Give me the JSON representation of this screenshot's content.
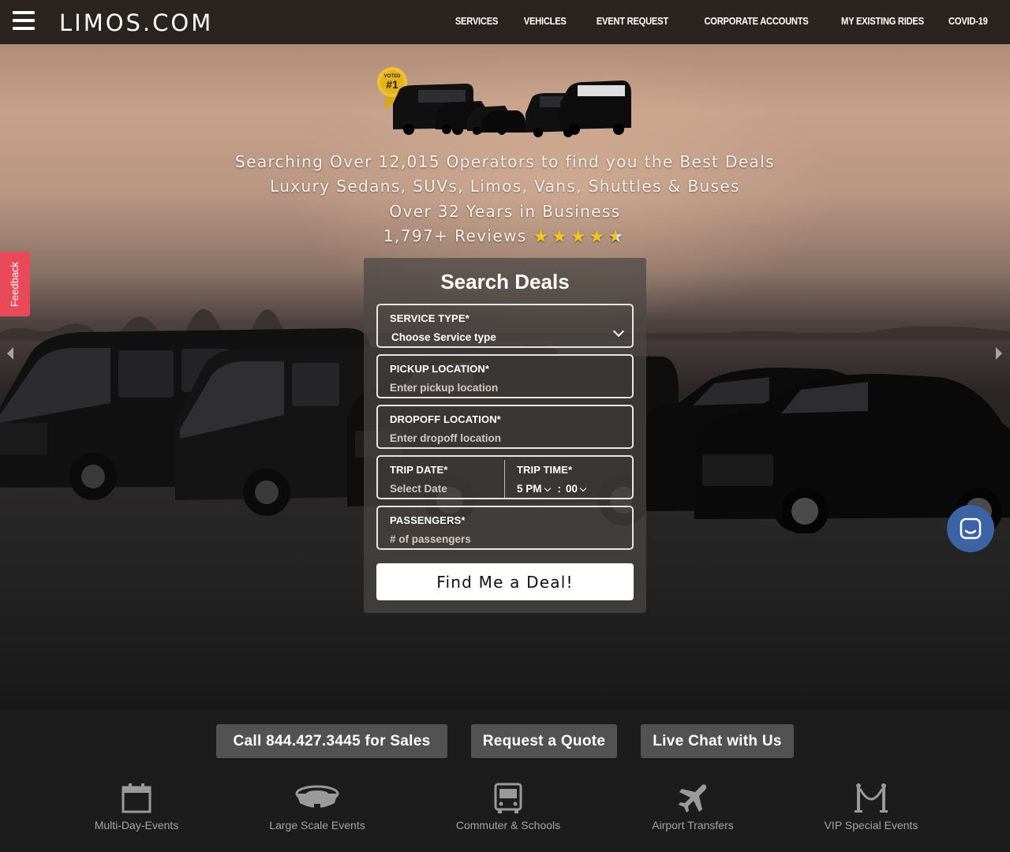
{
  "header": {
    "logo": "LIMOS.COM",
    "nav": [
      "SERVICES",
      "VEHICLES",
      "EVENT REQUEST",
      "CORPORATE ACCOUNTS",
      "MY EXISTING RIDES",
      "COVID-19"
    ]
  },
  "hero": {
    "badge": {
      "top": "VOTED",
      "rank": "#1"
    },
    "tagline_1": "Searching Over 12,015 Operators to find you the Best Deals",
    "tagline_2": "Luxury Sedans, SUVs, Limos, Vans, Shuttles & Buses",
    "tagline_3": "Over 32 Years in Business",
    "reviews": "1,797+ Reviews",
    "rating": 4.5,
    "feedback_label": "Feedback"
  },
  "search": {
    "title": "Search Deals",
    "service_type": {
      "label": "SERVICE TYPE*",
      "value": "Choose Service type"
    },
    "pickup": {
      "label": "PICKUP LOCATION*",
      "placeholder": "Enter pickup location"
    },
    "dropoff": {
      "label": "DROPOFF LOCATION*",
      "placeholder": "Enter dropoff location"
    },
    "trip_date": {
      "label": "TRIP DATE*",
      "placeholder": "Select Date"
    },
    "trip_time": {
      "label": "TRIP TIME*",
      "hour": "5 PM",
      "separator": ":",
      "minute": "00"
    },
    "passengers": {
      "label": "PASSENGERS*",
      "placeholder": "# of passengers"
    },
    "submit": "Find Me a Deal!"
  },
  "actions": [
    "Call 844.427.3445 for Sales",
    "Request a Quote",
    "Live Chat with Us"
  ],
  "categories": [
    "Multi-Day-Events",
    "Large Scale Events",
    "Commuter & Schools",
    "Airport Transfers",
    "VIP Special Events"
  ],
  "colors": {
    "header_bg": "#2a2420",
    "feedback": "#e84a5a",
    "chat": "#3d63a5",
    "star": "#f2c32a",
    "action_btn": "#525252"
  }
}
